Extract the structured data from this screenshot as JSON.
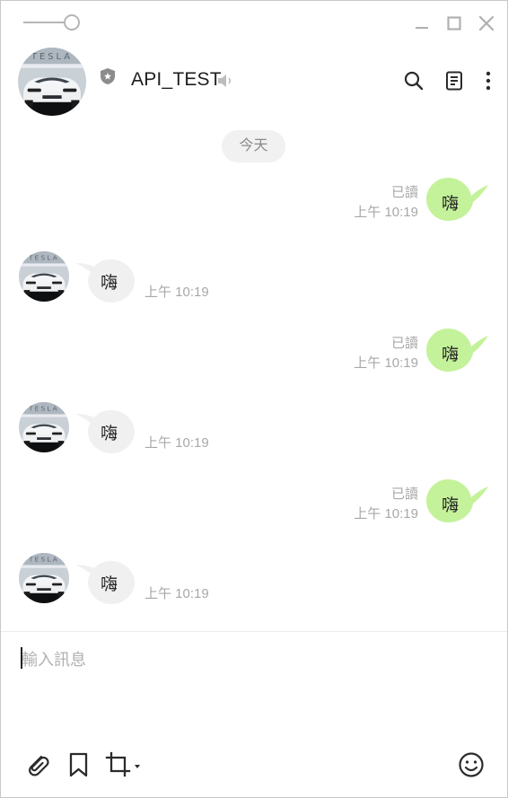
{
  "chat": {
    "name": "API_TEST"
  },
  "date_separator": "今天",
  "messages": [
    {
      "direction": "out",
      "text": "嗨",
      "read": "已讀",
      "time": "上午 10:19"
    },
    {
      "direction": "in",
      "text": "嗨",
      "time": "上午 10:19"
    },
    {
      "direction": "out",
      "text": "嗨",
      "read": "已讀",
      "time": "上午 10:19"
    },
    {
      "direction": "in",
      "text": "嗨",
      "time": "上午 10:19"
    },
    {
      "direction": "out",
      "text": "嗨",
      "read": "已讀",
      "time": "上午 10:19"
    },
    {
      "direction": "in",
      "text": "嗨",
      "time": "上午 10:19"
    }
  ],
  "composer": {
    "placeholder": "輸入訊息"
  },
  "icons": {
    "header": [
      "search-icon",
      "notes-icon",
      "more-icon"
    ],
    "footer": [
      "attach-icon",
      "bookmark-icon",
      "screenshot-icon",
      "emoji-icon"
    ]
  },
  "colors": {
    "outgoing_bubble": "#c4f29a",
    "incoming_bubble": "#f0f0f0",
    "icon": "#2b2b2b",
    "muted": "#a8a8a8"
  }
}
